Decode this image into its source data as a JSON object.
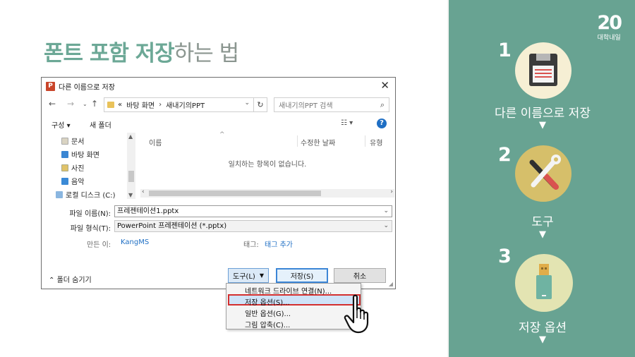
{
  "slide": {
    "title_accent": "폰트 포함 저장",
    "title_rest": "하는 법"
  },
  "dialog": {
    "title": "다른 이름으로 저장",
    "breadcrumb": [
      "«",
      "바탕 화면",
      "새내기의PPT"
    ],
    "search_placeholder": "새내기의PPT 검색",
    "toolbar": {
      "organize": "구성 ▾",
      "new_folder": "새 폴더"
    },
    "tree": [
      "문서",
      "바탕 화면",
      "사진",
      "음악",
      "로컬 디스크 (C:)"
    ],
    "columns": [
      "이름",
      "수정한 날짜",
      "유형"
    ],
    "empty_message": "일치하는 항목이 없습니다.",
    "filename_label": "파일 이름(N):",
    "filename_value": "프레젠테이션1.pptx",
    "filetype_label": "파일 형식(T):",
    "filetype_value": "PowerPoint 프레젠테이션 (*.pptx)",
    "author_label": "만든 이:",
    "author_value": "KangMS",
    "tags_label": "태그:",
    "tags_value": "태그 추가",
    "hide_folders": "폴더 숨기기",
    "tools_button": "도구(L)",
    "save_button": "저장(S)",
    "cancel_button": "취소"
  },
  "menu": {
    "items": [
      "네트워크 드라이브 연결(N)...",
      "저장 옵션(S)...",
      "일반 옵션(G)...",
      "그림 압축(C)..."
    ],
    "highlighted_index": 1
  },
  "panel": {
    "logo_big": "20",
    "logo_small": "대학내일",
    "steps": [
      {
        "number": "1",
        "label": "다른 이름으로 저장",
        "icon": "floppy-disk-icon"
      },
      {
        "number": "2",
        "label": "도구",
        "icon": "wrench-screwdriver-icon"
      },
      {
        "number": "3",
        "label": "저장 옵션",
        "icon": "usb-drive-icon"
      }
    ],
    "arrow": "▼"
  },
  "colors": {
    "accent": "#68a392",
    "title_accent": "#6ca896",
    "highlight_border": "#d32f2f",
    "link": "#1f6fc4"
  }
}
